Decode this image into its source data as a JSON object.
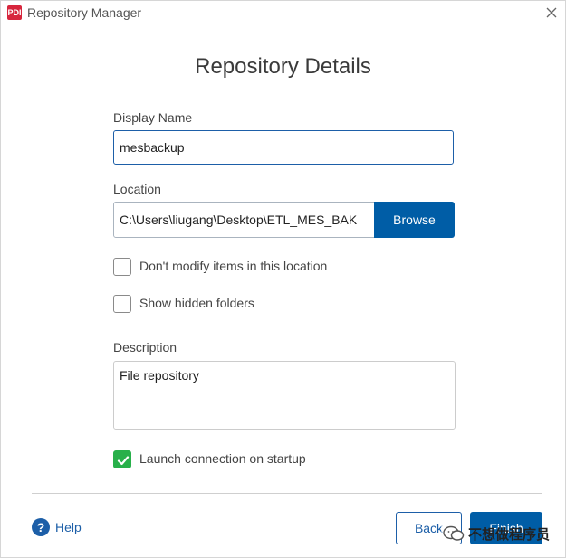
{
  "window": {
    "title": "Repository Manager",
    "app_icon_text": "PDI"
  },
  "dialog": {
    "title": "Repository Details"
  },
  "display_name": {
    "label": "Display Name",
    "value": "mesbackup"
  },
  "location": {
    "label": "Location",
    "value": "C:\\Users\\liugang\\Desktop\\ETL_MES_BAK",
    "browse_label": "Browse"
  },
  "options": {
    "dont_modify_label": "Don't modify items in this location",
    "dont_modify_checked": false,
    "show_hidden_label": "Show hidden folders",
    "show_hidden_checked": false
  },
  "description": {
    "label": "Description",
    "value": "File repository"
  },
  "launch": {
    "label": "Launch connection on startup",
    "checked": true
  },
  "footer": {
    "help_label": "Help",
    "back_label": "Back",
    "finish_label": "Finish"
  },
  "watermark": {
    "text": "不想做程序员"
  },
  "colors": {
    "primary": "#005da6",
    "checkbox_checked": "#28b04a",
    "app_icon": "#d7263d"
  }
}
